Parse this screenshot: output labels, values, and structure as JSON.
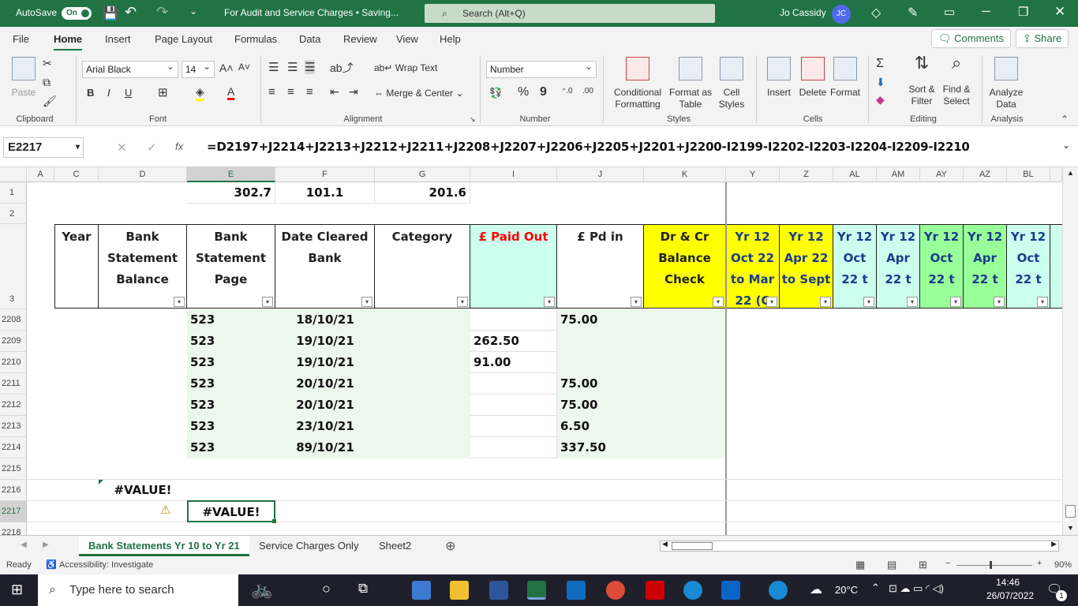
{
  "titlebar": {
    "autosave_label": "AutoSave",
    "autosave_state": "On",
    "doc_title": "For Audit and Service Charges • Saving...",
    "search_placeholder": "Search (Alt+Q)",
    "user_name": "Jo Cassidy",
    "user_initials": "JC"
  },
  "menu": {
    "items": [
      "File",
      "Home",
      "Insert",
      "Page Layout",
      "Formulas",
      "Data",
      "Review",
      "View",
      "Help"
    ],
    "comments": "Comments",
    "share": "Share"
  },
  "ribbon": {
    "clipboard": {
      "paste": "Paste",
      "group": "Clipboard"
    },
    "font": {
      "name": "Arial Black",
      "size": "14",
      "group": "Font",
      "bold": "B",
      "italic": "I",
      "underline": "U"
    },
    "alignment": {
      "wrap": "Wrap Text",
      "merge": "Merge & Center",
      "group": "Alignment"
    },
    "number": {
      "format": "Number",
      "group": "Number",
      "percent": "%",
      "comma": "9"
    },
    "styles": {
      "cond": "Conditional Formatting",
      "table": "Format as Table",
      "cell": "Cell Styles",
      "group": "Styles"
    },
    "cells": {
      "insert": "Insert",
      "delete": "Delete",
      "format": "Format",
      "group": "Cells"
    },
    "editing": {
      "sort": "Sort & Filter",
      "find": "Find & Select",
      "group": "Editing"
    },
    "analysis": {
      "analyze": "Analyze Data",
      "group": "Analysis"
    }
  },
  "formula_bar": {
    "name_box": "E2217",
    "fx": "fx",
    "formula": "=D2197+J2214+J2213+J2212+J2211+J2208+J2207+J2206+J2205+J2201+J2200-I2199-I2202-I2203-I2204-I2209-I2210"
  },
  "columns": [
    "A",
    "C",
    "D",
    "E",
    "F",
    "G",
    "I",
    "J",
    "K",
    "Y",
    "Z",
    "AL",
    "AM",
    "AY",
    "AZ",
    "BL"
  ],
  "row1": {
    "E": "302.7",
    "F": "101.1",
    "G": "201.6"
  },
  "headers": {
    "C": "Year",
    "D": "Bank Statement Balance",
    "E": "Bank Statement Page",
    "F": "Date Cleared Bank",
    "G": "Category",
    "I": "£ Paid Out",
    "J": "£ Pd in",
    "K": "Dr & Cr Balance Check",
    "Y": "Yr 12 Oct 22 to Mar 22 (C",
    "Z": "Yr 12 Apr 22 to Sept",
    "AL": "Yr 12 Oct 22 t",
    "AM": "Yr 12 Apr 22 t",
    "AY": "Yr 12 Oct 22 t",
    "AZ": "Yr 12 Apr 22 t",
    "BL": "Yr 12 Oct 22 t"
  },
  "rows": [
    {
      "num": "1"
    },
    {
      "num": "2"
    },
    {
      "num": "3"
    },
    {
      "num": "2208",
      "E": "523",
      "F": "18/10/21",
      "I": "",
      "J": "75.00"
    },
    {
      "num": "2209",
      "E": "523",
      "F": "19/10/21",
      "I": "262.50",
      "J": ""
    },
    {
      "num": "2210",
      "E": "523",
      "F": "19/10/21",
      "I": "91.00",
      "J": ""
    },
    {
      "num": "2211",
      "E": "523",
      "F": "20/10/21",
      "I": "",
      "J": "75.00"
    },
    {
      "num": "2212",
      "E": "523",
      "F": "20/10/21",
      "I": "",
      "J": "75.00"
    },
    {
      "num": "2213",
      "E": "523",
      "F": "23/10/21",
      "I": "",
      "J": "6.50"
    },
    {
      "num": "2214",
      "E": "523",
      "F": "89/10/21",
      "I": "",
      "J": "337.50"
    },
    {
      "num": "2215"
    },
    {
      "num": "2216",
      "D": "#VALUE!"
    },
    {
      "num": "2217",
      "E": "#VALUE!"
    },
    {
      "num": "2218"
    }
  ],
  "sheets": [
    "Bank Statements Yr 10 to Yr 21",
    "Service Charges Only",
    "Sheet2"
  ],
  "status": {
    "ready": "Ready",
    "accessibility": "Accessibility: Investigate",
    "zoom": "90%"
  },
  "taskbar": {
    "search": "Type here to search",
    "temp": "20°C",
    "time": "14:46",
    "date": "26/07/2022",
    "notif": "1"
  },
  "colors": {
    "accent": "#217346",
    "header_yellow": "#ffff00",
    "header_mint": "#ccffee",
    "header_green": "#99ff99",
    "data_green": "#ebf8eb",
    "paid_out_red": "#ff0000"
  }
}
